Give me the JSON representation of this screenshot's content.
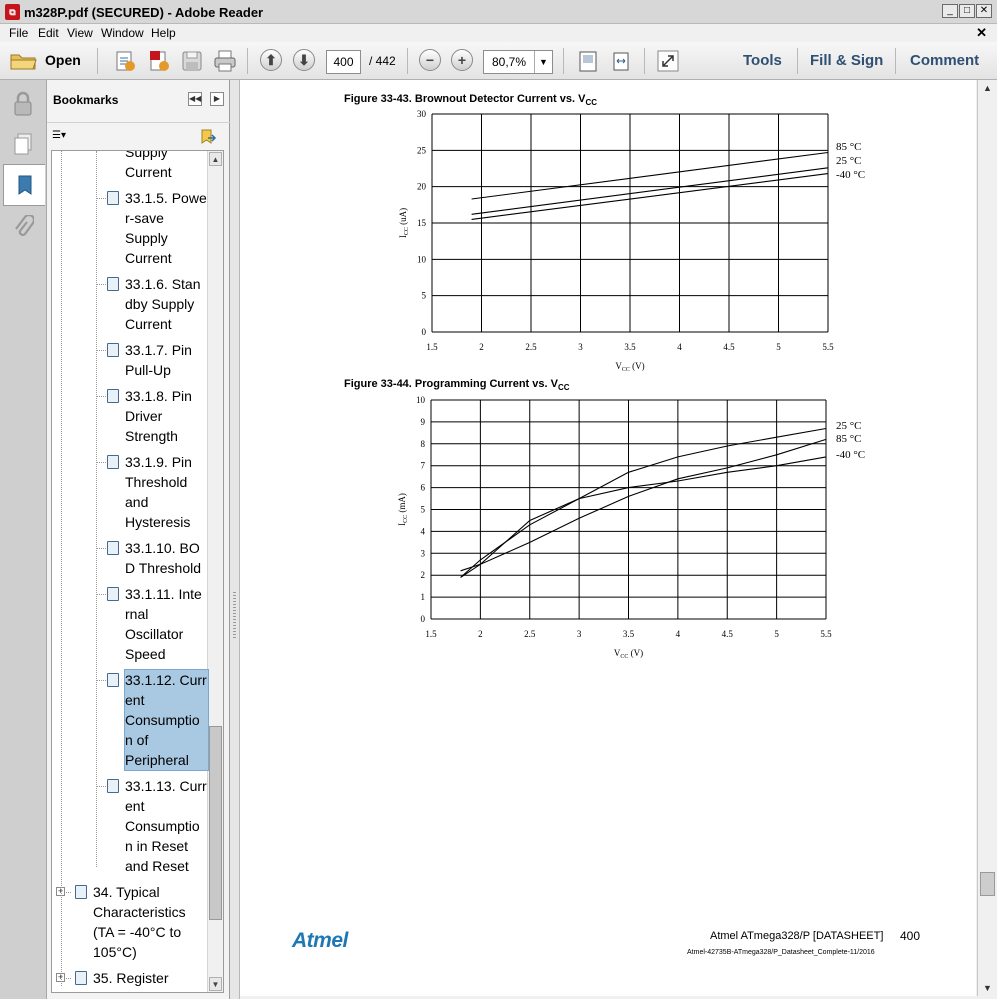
{
  "window": {
    "title": "m328P.pdf (SECURED) - Adobe Reader",
    "icon": "pdf-app-icon"
  },
  "menu": [
    "File",
    "Edit",
    "View",
    "Window",
    "Help"
  ],
  "toolbar": {
    "open_label": "Open",
    "page_current": "400",
    "page_total": "/ 442",
    "zoom": "80,7%",
    "tools": "Tools",
    "fill_sign": "Fill & Sign",
    "comment": "Comment"
  },
  "bookmarks": {
    "header": "Bookmarks",
    "items": [
      {
        "lines": [
          "Supply",
          "Current"
        ],
        "partial": true
      },
      {
        "lines": [
          "33.1.5. Powe",
          "r-save",
          "Supply",
          "Current"
        ]
      },
      {
        "lines": [
          "33.1.6. Stan",
          "dby Supply",
          "Current"
        ]
      },
      {
        "lines": [
          "33.1.7. Pin",
          "Pull-Up"
        ]
      },
      {
        "lines": [
          "33.1.8. Pin",
          "Driver",
          "Strength"
        ]
      },
      {
        "lines": [
          "33.1.9. Pin",
          "Threshold",
          "and",
          "Hysteresis"
        ]
      },
      {
        "lines": [
          "33.1.10. BO",
          "D Threshold"
        ]
      },
      {
        "lines": [
          "33.1.11. Inte",
          "rnal",
          "Oscillator",
          "Speed"
        ]
      },
      {
        "lines": [
          "33.1.12. Curr",
          "ent",
          "Consumptio",
          "n of",
          "Peripheral"
        ],
        "selected": true
      },
      {
        "lines": [
          "33.1.13. Curr",
          "ent",
          "Consumptio",
          "n in Reset",
          "and Reset"
        ]
      },
      {
        "lines": [
          "34. Typical",
          "Characteristics",
          "(TA = -40°C to",
          "105°C)"
        ],
        "top_level": true
      },
      {
        "lines": [
          "35. Register"
        ],
        "top_level": true
      }
    ]
  },
  "page": {
    "footer_brand": "Atmel",
    "footer_title": "Atmel ATmega328/P [DATASHEET]",
    "footer_page": "400",
    "footer_doc": "Atmel-42735B-ATmega328/P_Datasheet_Complete-11/2016"
  },
  "chart_data": [
    {
      "type": "line",
      "caption_main": "Figure 33-43.  Brownout Detector Current vs. V",
      "caption_sub": "CC",
      "xlabel_main": "V",
      "xlabel_sub": "CC",
      "xlabel_unit": " (V)",
      "ylabel": "I",
      "ylabel_sub": "CC",
      "ylabel_unit": " (uA)",
      "xlim": [
        1.5,
        5.5
      ],
      "ylim": [
        0,
        30
      ],
      "xticks": [
        "1.5",
        "2",
        "2.5",
        "3",
        "3.5",
        "4",
        "4.5",
        "5",
        "5.5"
      ],
      "yticks": [
        "0",
        "5",
        "10",
        "15",
        "20",
        "25",
        "30"
      ],
      "series": [
        {
          "name": "85 °C",
          "x": [
            1.9,
            5.5
          ],
          "y": [
            18.3,
            24.7
          ]
        },
        {
          "name": "25 °C",
          "x": [
            1.9,
            5.5
          ],
          "y": [
            16.2,
            22.6
          ]
        },
        {
          "name": "-40 °C",
          "x": [
            1.9,
            5.5
          ],
          "y": [
            15.5,
            21.8
          ]
        }
      ]
    },
    {
      "type": "line",
      "caption_main": "Figure 33-44.  Programming Current vs. V",
      "caption_sub": "CC",
      "xlabel_main": "V",
      "xlabel_sub": "CC",
      "xlabel_unit": " (V)",
      "ylabel": "I",
      "ylabel_sub": "CC",
      "ylabel_unit": " (mA)",
      "xlim": [
        1.5,
        5.5
      ],
      "ylim": [
        0,
        10
      ],
      "xticks": [
        "1.5",
        "2",
        "2.5",
        "3",
        "3.5",
        "4",
        "4.5",
        "5",
        "5.5"
      ],
      "yticks": [
        "0",
        "1",
        "2",
        "3",
        "4",
        "5",
        "6",
        "7",
        "8",
        "9",
        "10"
      ],
      "series": [
        {
          "name": "25 °C",
          "x": [
            1.8,
            2.0,
            2.5,
            3.0,
            3.5,
            4.0,
            4.5,
            5.0,
            5.5
          ],
          "y": [
            1.9,
            2.7,
            4.3,
            5.5,
            6.7,
            7.4,
            7.9,
            8.3,
            8.7
          ]
        },
        {
          "name": "85 °C",
          "x": [
            1.8,
            2.0,
            2.5,
            3.0,
            3.5,
            4.0,
            4.5,
            5.0,
            5.5
          ],
          "y": [
            1.9,
            2.5,
            3.5,
            4.6,
            5.6,
            6.4,
            6.9,
            7.5,
            8.2
          ]
        },
        {
          "name": "-40 °C",
          "x": [
            1.8,
            2.0,
            2.5,
            3.0,
            3.5,
            4.0,
            4.5,
            5.0,
            5.5
          ],
          "y": [
            2.2,
            2.5,
            4.5,
            5.5,
            6.0,
            6.3,
            6.7,
            7.0,
            7.4
          ]
        }
      ]
    }
  ]
}
